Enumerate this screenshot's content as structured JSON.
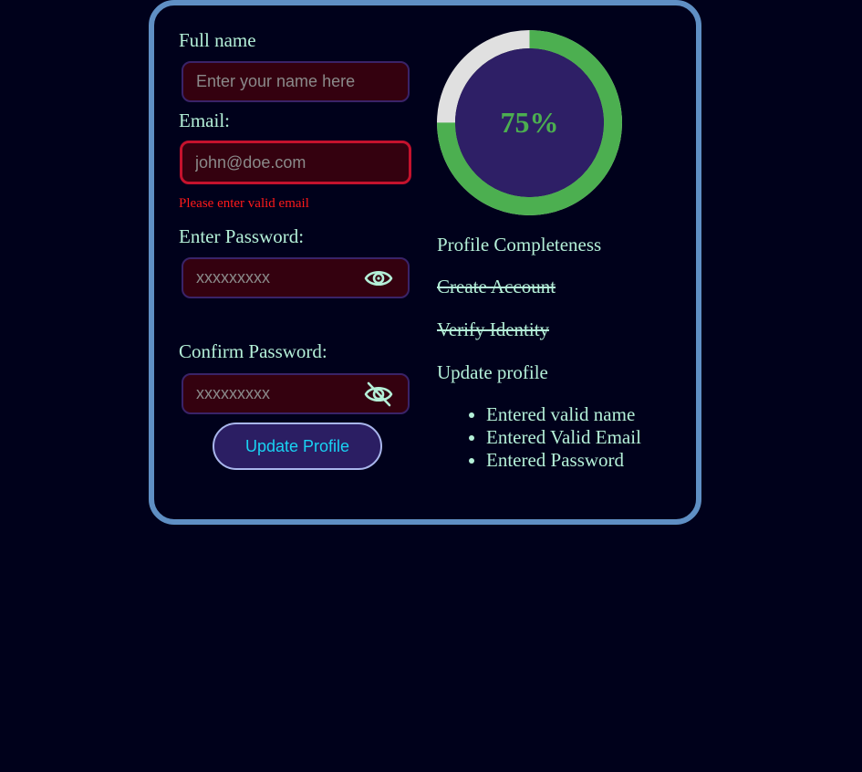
{
  "form": {
    "full_name_label": "Full name",
    "full_name_placeholder": "Enter your name here",
    "email_label": "Email:",
    "email_placeholder": "john@doe.com",
    "email_error": "Please enter valid email",
    "password_label": "Enter Password:",
    "password_placeholder": "xxxxxxxxx",
    "confirm_password_label": "Confirm Password:",
    "confirm_password_placeholder": "xxxxxxxxx",
    "submit_label": "Update Profile"
  },
  "progress": {
    "percent": 75,
    "percent_label": "75%",
    "track_color": "#e0e0e0",
    "fill_color": "#4caf50",
    "inner_color": "#2e1f66"
  },
  "completeness": {
    "title": "Profile Completeness",
    "steps": [
      {
        "label": "Create Account",
        "done": true
      },
      {
        "label": "Verify Identity",
        "done": true
      },
      {
        "label": "Update profile",
        "done": false
      }
    ],
    "checklist": [
      "Entered valid name",
      "Entered Valid Email",
      "Entered Password"
    ]
  },
  "icons": {
    "password_toggle": "eye-icon",
    "confirm_toggle": "eye-off-icon"
  },
  "colors": {
    "background": "#00011b",
    "card_border": "#5f8fc4",
    "text": "#b4f0d8",
    "error": "#ff1a1a",
    "button_text": "#19d3f3"
  }
}
